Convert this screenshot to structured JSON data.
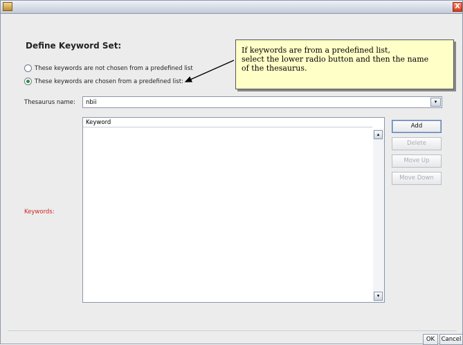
{
  "window": {
    "close_glyph": "X",
    "app_icon": "java-coffee-cup-icon"
  },
  "heading": "Define Keyword Set:",
  "radios": [
    {
      "label": "These keywords are not chosen from a predefined list",
      "selected": false
    },
    {
      "label": "These keywords are chosen from a predefined list:",
      "selected": true
    }
  ],
  "callout": {
    "lines": [
      "If keywords are from a predefined list,",
      "select the lower radio button and then the name",
      "of the thesaurus."
    ]
  },
  "thesaurus": {
    "label": "Thesaurus name:",
    "value": "nbii",
    "dropdown_glyph": "▾"
  },
  "table": {
    "column_header": "Keyword",
    "rows": []
  },
  "keywords_label": "Keywords:",
  "buttons": {
    "add": "Add",
    "delete": "Delete",
    "move_up": "Move Up",
    "move_down": "Move Down",
    "ok": "OK",
    "cancel": "Cancel"
  },
  "scroll": {
    "up_glyph": "▴",
    "down_glyph": "▾"
  },
  "colors": {
    "required_label": "#d02323",
    "callout_bg": "#ffffc8"
  }
}
